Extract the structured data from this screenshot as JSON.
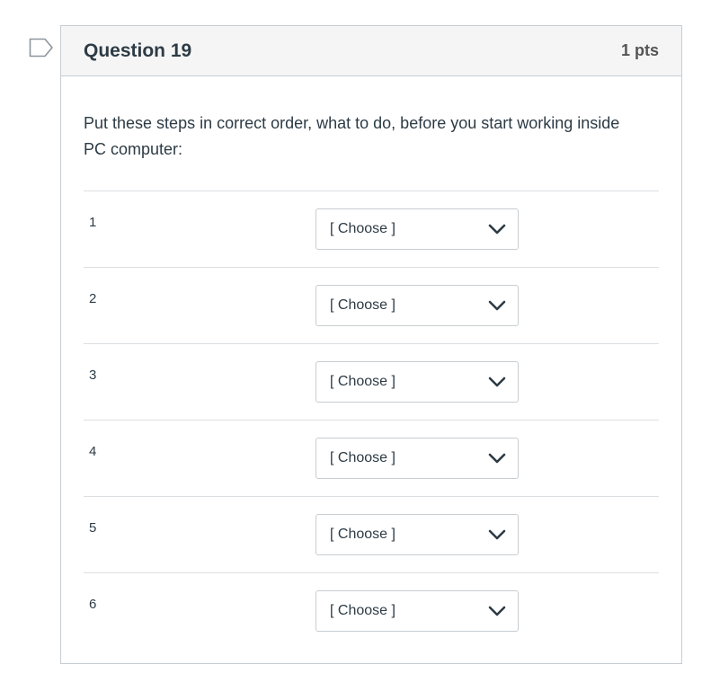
{
  "question": {
    "title": "Question 19",
    "points": "1 pts",
    "text": "Put these steps in correct order, what to do, before you start working inside PC computer:"
  },
  "icons": {
    "flag": "flag-outline-icon",
    "dropdown": "chevron-down-icon"
  },
  "answers": [
    {
      "label": "1",
      "selected": "[ Choose ]"
    },
    {
      "label": "2",
      "selected": "[ Choose ]"
    },
    {
      "label": "3",
      "selected": "[ Choose ]"
    },
    {
      "label": "4",
      "selected": "[ Choose ]"
    },
    {
      "label": "5",
      "selected": "[ Choose ]"
    },
    {
      "label": "6",
      "selected": "[ Choose ]"
    }
  ],
  "colors": {
    "header_bg": "#f5f5f5",
    "border": "#c7cdd1",
    "text": "#2d3b45",
    "points": "#555555"
  }
}
